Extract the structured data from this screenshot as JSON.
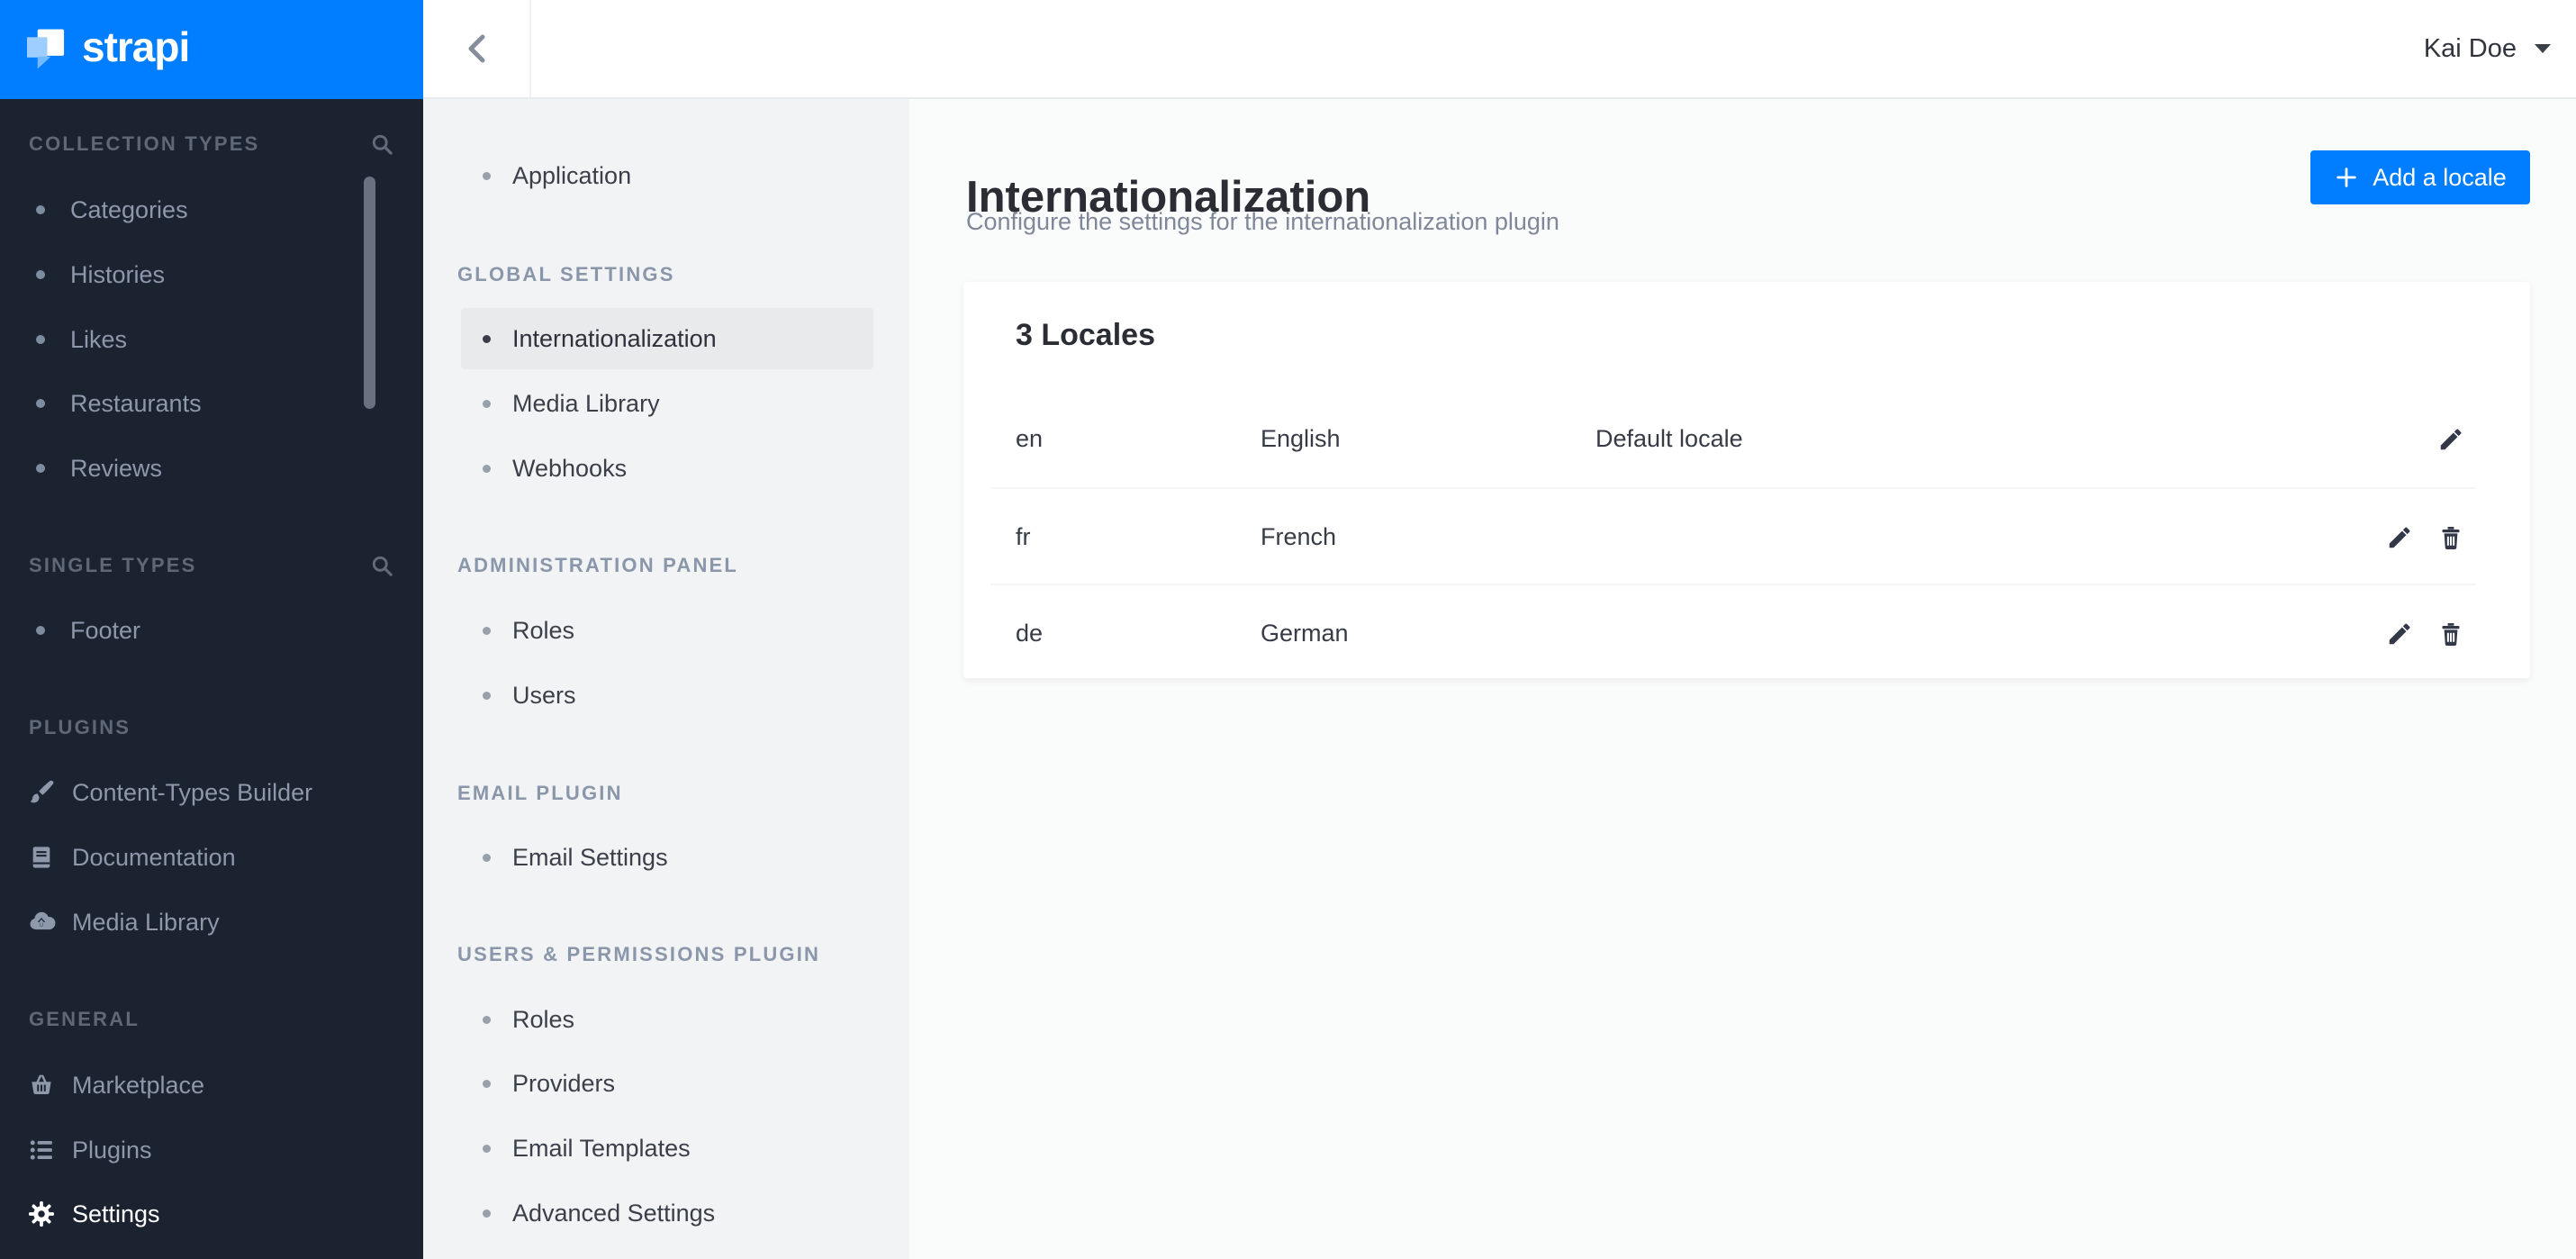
{
  "colors": {
    "accent": "#007eff",
    "sidebar_bg": "#1b2230",
    "settings_nav_bg": "#f2f3f4",
    "selected_item_bg": "#e9eaec"
  },
  "brand": {
    "logo_text": "strapi"
  },
  "topbar": {
    "user_name": "Kai Doe"
  },
  "left_sidebar": {
    "sections": [
      {
        "label": "COLLECTION TYPES",
        "items": [
          {
            "label": "Categories"
          },
          {
            "label": "Histories"
          },
          {
            "label": "Likes"
          },
          {
            "label": "Restaurants"
          },
          {
            "label": "Reviews"
          }
        ]
      },
      {
        "label": "SINGLE TYPES",
        "items": [
          {
            "label": "Footer"
          }
        ]
      },
      {
        "label": "PLUGINS",
        "items": [
          {
            "label": "Content-Types Builder",
            "icon": "brush"
          },
          {
            "label": "Documentation",
            "icon": "book"
          },
          {
            "label": "Media Library",
            "icon": "cloud-upload"
          }
        ]
      },
      {
        "label": "GENERAL",
        "items": [
          {
            "label": "Marketplace",
            "icon": "basket"
          },
          {
            "label": "Plugins",
            "icon": "list"
          },
          {
            "label": "Settings",
            "icon": "gear",
            "active": true
          }
        ]
      }
    ]
  },
  "settings_nav": {
    "groups": [
      {
        "header": "",
        "items": [
          {
            "label": "Application"
          }
        ]
      },
      {
        "header": "GLOBAL SETTINGS",
        "items": [
          {
            "label": "Internationalization",
            "selected": true
          },
          {
            "label": "Media Library"
          },
          {
            "label": "Webhooks"
          }
        ]
      },
      {
        "header": "ADMINISTRATION PANEL",
        "items": [
          {
            "label": "Roles"
          },
          {
            "label": "Users"
          }
        ]
      },
      {
        "header": "EMAIL PLUGIN",
        "items": [
          {
            "label": "Email Settings"
          }
        ]
      },
      {
        "header": "USERS & PERMISSIONS PLUGIN",
        "items": [
          {
            "label": "Roles"
          },
          {
            "label": "Providers"
          },
          {
            "label": "Email Templates"
          },
          {
            "label": "Advanced Settings"
          }
        ]
      }
    ]
  },
  "main": {
    "title": "Internationalization",
    "subtitle": "Configure the settings for the internationalization plugin",
    "add_locale_button": {
      "label": "Add a locale"
    },
    "locales_card": {
      "title": "3 Locales",
      "rows": [
        {
          "code": "en",
          "name": "English",
          "status": "Default locale"
        },
        {
          "code": "fr",
          "name": "French",
          "status": ""
        },
        {
          "code": "de",
          "name": "German",
          "status": ""
        }
      ]
    }
  }
}
